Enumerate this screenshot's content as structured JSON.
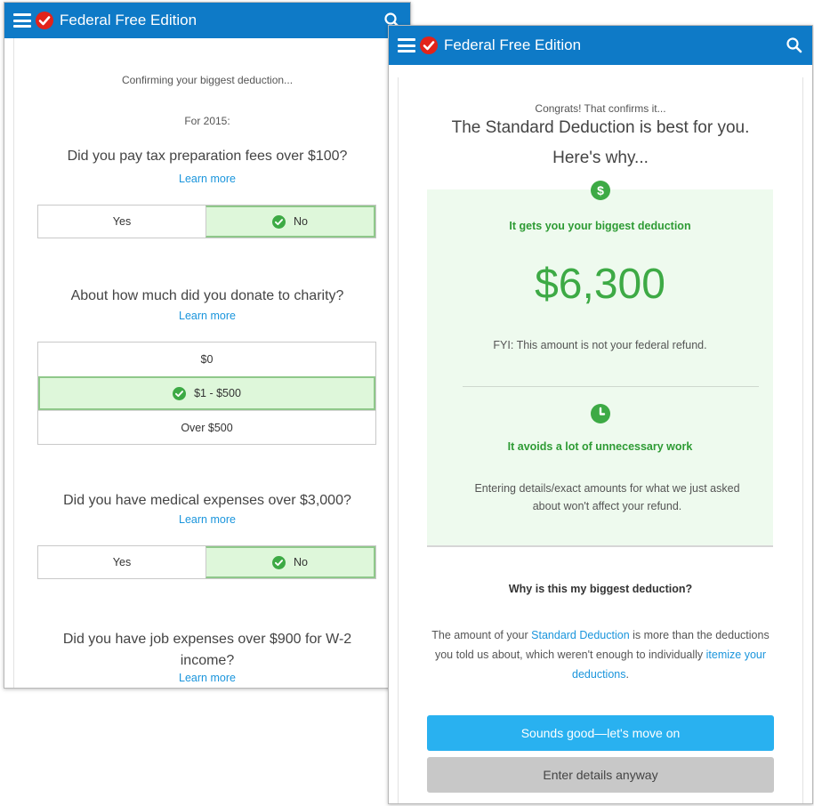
{
  "app": {
    "title": "Federal Free Edition"
  },
  "left_screen": {
    "intro": "Confirming your biggest deduction...",
    "year_label": "For 2015:",
    "questions": [
      {
        "text": "Did you pay tax preparation fees over $100?",
        "learn_more": "Learn more",
        "options": [
          "Yes",
          "No"
        ],
        "selected": "No"
      },
      {
        "text": "About how much did you donate to charity?",
        "learn_more": "Learn more",
        "options": [
          "$0",
          "$1 - $500",
          "Over $500"
        ],
        "selected": "$1 - $500"
      },
      {
        "text": "Did you have medical expenses over $3,000?",
        "learn_more": "Learn more",
        "options": [
          "Yes",
          "No"
        ],
        "selected": "No"
      },
      {
        "text": "Did you have job expenses over $900 for W-2 income?",
        "learn_more": "Learn more"
      }
    ]
  },
  "right_screen": {
    "congrats": "Congrats! That confirms it...",
    "headline_line1": "The Standard Deduction is best for you.",
    "headline_line2": "Here's why...",
    "reason1": {
      "icon": "dollar-icon",
      "heading": "It gets you your biggest deduction",
      "amount": "$6,300",
      "note": "FYI: This amount is not your federal refund."
    },
    "reason2": {
      "icon": "clock-icon",
      "heading": "It avoids a lot of unnecessary work",
      "text": "Entering details/exact amounts for what we just asked about won't affect your refund."
    },
    "why": {
      "title": "Why is this my biggest deduction?",
      "text_part1": "The amount of your ",
      "link1": "Standard Deduction",
      "text_part2": " is more than the deductions you told us about, which weren't enough to individually ",
      "link2": "itemize your deductions",
      "text_part3": "."
    },
    "primary_button": "Sounds good—let's move on",
    "secondary_button": "Enter details anyway"
  },
  "colors": {
    "header": "#0e7ac7",
    "selected_bg": "#def7da",
    "green_text": "#2e9b34",
    "link": "#1a95dc",
    "primary_button": "#29b1f0",
    "secondary_button": "#c8c8c8"
  }
}
